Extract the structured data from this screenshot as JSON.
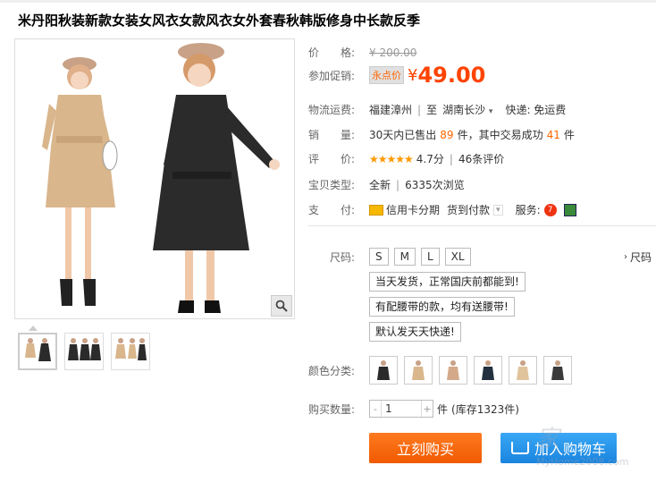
{
  "product": {
    "title": "米丹阳秋装新款女装女风衣女款风衣女外套春秋韩版修身中长款反季"
  },
  "price": {
    "label": "价　　格:",
    "original": "¥ 200.00",
    "promo_label": "参加促销:",
    "promo_tag": "永点价",
    "currency": "¥",
    "current": "49.00"
  },
  "shipping": {
    "label": "物流运费:",
    "from": "福建漳州",
    "to_prefix": "至",
    "to": "湖南长沙",
    "express": "快递: 免运费"
  },
  "sales": {
    "label": "销　　量:",
    "text_a": "30天内已售出",
    "sold": "89",
    "text_b": "件，其中交易成功",
    "success": "41",
    "text_c": "件"
  },
  "rating": {
    "label": "评　　价:",
    "stars": "★★★★★",
    "score": "4.7分",
    "reviews": "46条评价"
  },
  "item_type": {
    "label": "宝贝类型:",
    "value": "全新",
    "views": "6335次浏览"
  },
  "payment": {
    "label": "支　　付:",
    "credit": "信用卡分期",
    "cod": "货到付款",
    "service_label": "服务:"
  },
  "size": {
    "label": "尺码:",
    "options": [
      "S",
      "M",
      "L",
      "XL"
    ],
    "chart_link": "尺码"
  },
  "notes": [
    "当天发货，正常国庆前都能到!",
    "有配腰带的款，均有送腰带!",
    "默认发天天快递!"
  ],
  "color": {
    "label": "颜色分类:"
  },
  "quantity": {
    "label": "购买数量:",
    "value": "1",
    "unit": "件",
    "stock": "(库存1323件)"
  },
  "buttons": {
    "buy_now": "立刻购买",
    "add_cart": "加入购物车"
  },
  "watermark": {
    "main": "家",
    "site": "MyHome2008.com"
  },
  "colors": {
    "accent": "#ff4400",
    "buy": "#f26100",
    "cart": "#2b96eb"
  }
}
